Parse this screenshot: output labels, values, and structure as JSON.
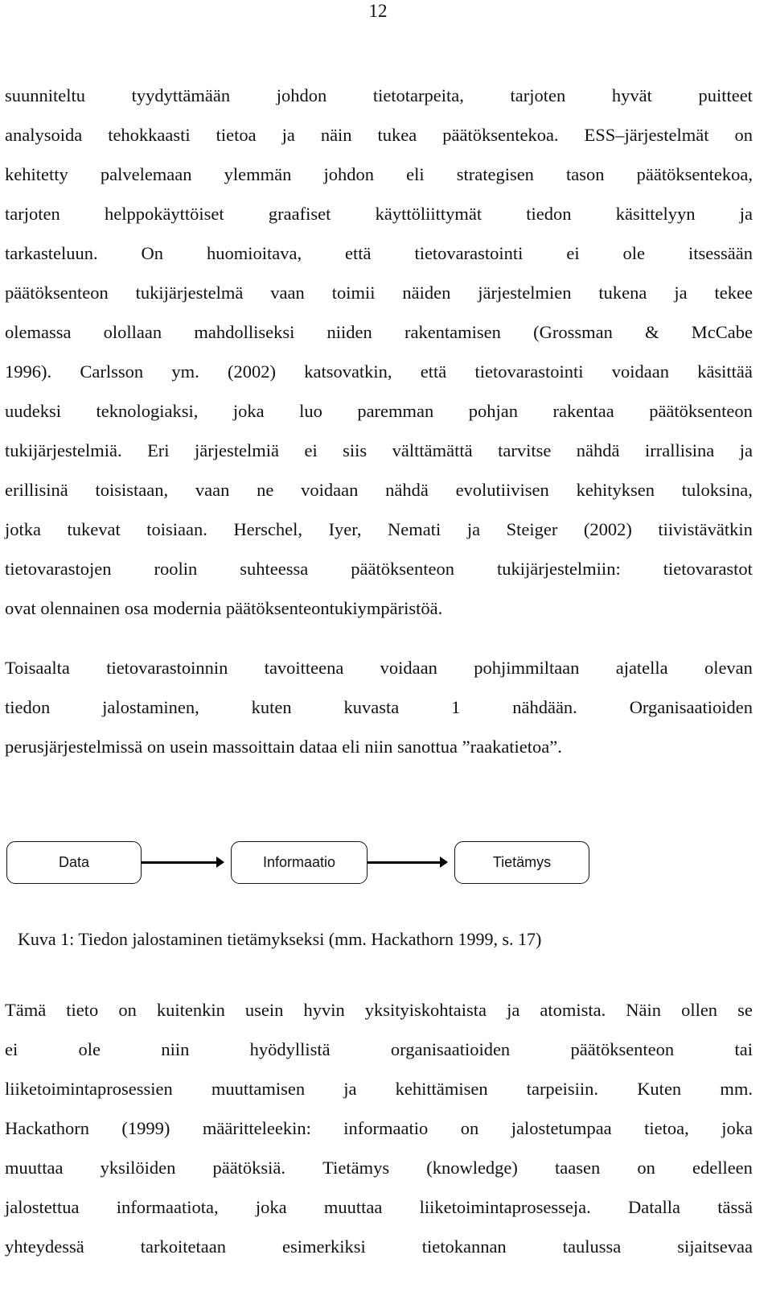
{
  "page_number": "12",
  "paragraphs": [
    {
      "lines": [
        "suunniteltu tyydyttämään johdon tietotarpeita, tarjoten hyvät puitteet",
        "analysoida tehokkaasti tietoa ja näin tukea päätöksentekoa. ESS–järjestelmät on",
        "kehitetty palvelemaan ylemmän johdon eli strategisen tason päätöksentekoa,",
        "tarjoten helppokäyttöiset graafiset käyttöliittymät tiedon käsittelyyn ja",
        "tarkasteluun. On huomioitava, että tietovarastointi ei ole itsessään",
        "päätöksenteon tukijärjestelmä vaan toimii näiden järjestelmien tukena ja tekee",
        "olemassa olollaan mahdolliseksi niiden rakentamisen (Grossman & McCabe",
        "1996). Carlsson ym. (2002) katsovatkin, että tietovarastointi voidaan käsittää",
        "uudeksi teknologiaksi, joka luo paremman pohjan rakentaa päätöksenteon",
        "tukijärjestelmiä. Eri järjestelmiä ei siis välttämättä tarvitse nähdä irrallisina ja",
        "erillisinä toisistaan, vaan ne voidaan nähdä evolutiivisen kehityksen tuloksina,",
        "jotka tukevat toisiaan. Herschel, Iyer, Nemati ja Steiger (2002) tiivistävätkin",
        "tietovarastojen roolin suhteessa päätöksenteon tukijärjestelmiin: tietovarastot",
        "ovat olennainen osa modernia päätöksenteontukiympäristöä."
      ]
    },
    {
      "lines": [
        "Toisaalta tietovarastoinnin tavoitteena voidaan pohjimmiltaan ajatella olevan",
        "tiedon jalostaminen, kuten kuvasta 1 nähdään. Organisaatioiden",
        "perusjärjestelmissä on usein massoittain dataa eli niin sanottua ”raakatietoa”."
      ]
    },
    {
      "lines": [
        "Tämä tieto on kuitenkin usein hyvin yksityiskohtaista ja atomista. Näin ollen se",
        "ei ole niin hyödyllistä organisaatioiden päätöksenteon tai",
        "liiketoimintaprosessien muuttamisen ja kehittämisen tarpeisiin. Kuten mm.",
        "Hackathorn (1999) määritteleekin: informaatio on jalostetumpaa tietoa, joka",
        "muuttaa yksilöiden päätöksiä. Tietämys (knowledge) taasen on edelleen",
        "jalostettua informaatiota, joka muuttaa liiketoimintaprosesseja. Datalla tässä",
        "yhteydessä tarkoitetaan esimerkiksi tietokannan taulussa sijaitsevaa"
      ]
    }
  ],
  "figure": {
    "nodes": [
      "Data",
      "Informaatio",
      "Tietämys"
    ],
    "edges": [
      {
        "from": "Data",
        "to": "Informaatio"
      },
      {
        "from": "Informaatio",
        "to": "Tietämys"
      }
    ],
    "caption": "Kuva 1: Tiedon jalostaminen tietämykseksi (mm. Hackathorn 1999, s. 17)"
  }
}
